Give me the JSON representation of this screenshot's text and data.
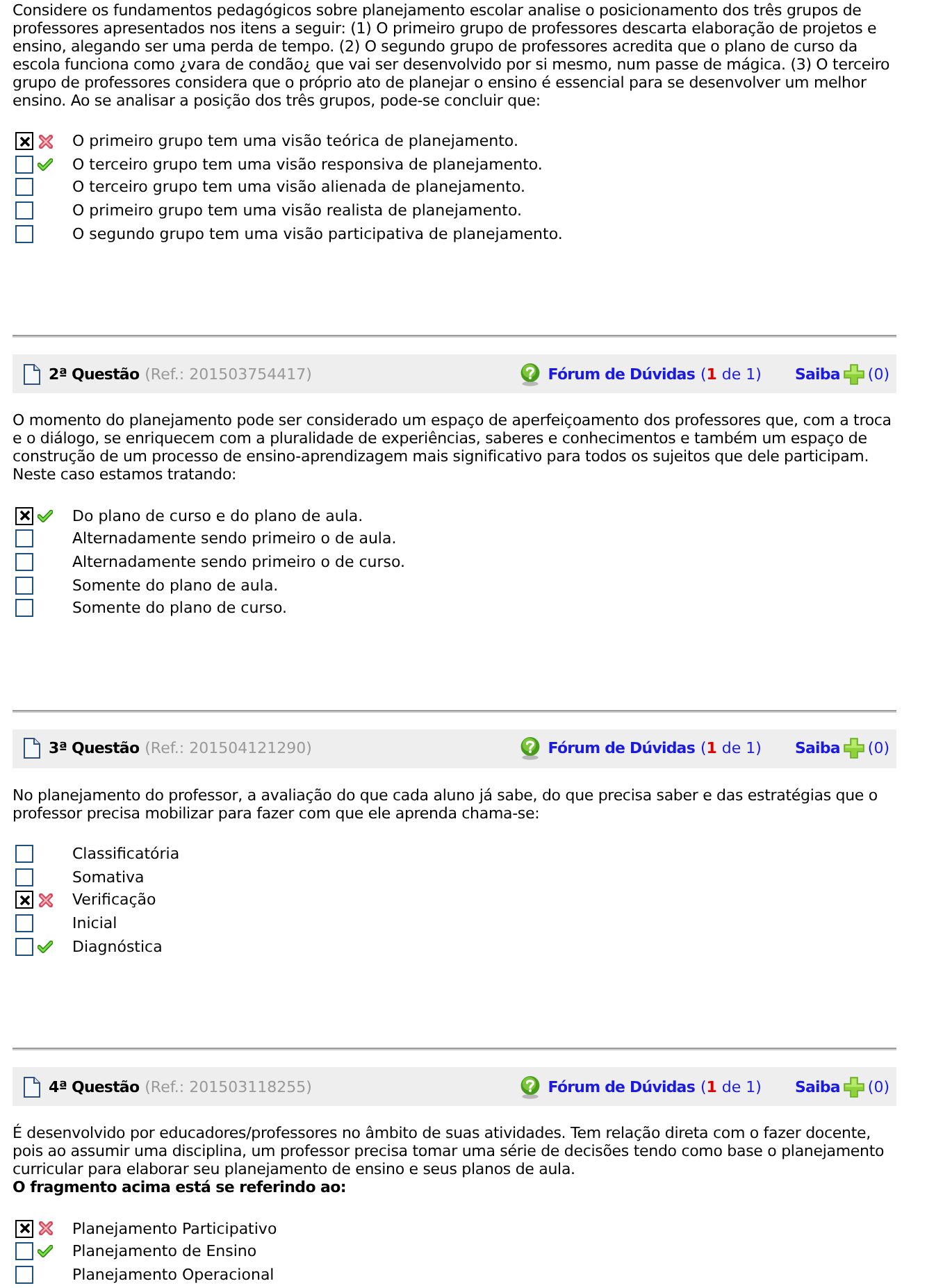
{
  "questions": [
    {
      "statement": "Considere os fundamentos pedagógicos sobre planejamento escolar analise o posicionamento dos três grupos de professores apresentados nos itens a seguir: (1) O primeiro grupo de professores descarta elaboração de projetos e ensino, alegando ser uma perda de tempo. (2) O segundo grupo de professores acredita que o plano de curso da escola funciona como ¿vara de condão¿ que vai ser desenvolvido por si mesmo, num passe de mágica. (3) O terceiro grupo de professores considera que o próprio ato de planejar o ensino é essencial para se desenvolver um melhor ensino. Ao se analisar a posição dos três grupos, pode-se concluir que:",
      "options": [
        {
          "text": "O primeiro grupo tem uma visão teórica de planejamento.",
          "checked": true,
          "correct": false
        },
        {
          "text": "O terceiro grupo tem uma visão responsiva de planejamento.",
          "checked": false,
          "correct": true
        },
        {
          "text": "O terceiro grupo tem uma visão alienada de planejamento.",
          "checked": false,
          "correct": false
        },
        {
          "text": "O primeiro grupo tem uma visão realista de planejamento.",
          "checked": false,
          "correct": false
        },
        {
          "text": "O segundo grupo tem uma visão participativa de planejamento.",
          "checked": false,
          "correct": false
        }
      ]
    },
    {
      "header": {
        "title": "2ª Questão",
        "ref": "(Ref.: 201503754417)",
        "forum_link": "Fórum de Dúvidas",
        "forum_count": "(**1** de 1)",
        "more_link": "Saiba",
        "more_count": "(0)"
      },
      "statement": "O momento do planejamento pode ser considerado um espaço de aperfeiçoamento dos professores que, com a troca e o diálogo, se enriquecem com a pluralidade de experiências, saberes e conhecimentos e também um espaço de construção de um processo de ensino-aprendizagem mais significativo para todos os sujeitos que dele participam. Neste caso estamos tratando:",
      "options": [
        {
          "text": "Do plano de curso e do plano de aula.",
          "checked": true,
          "correct": true
        },
        {
          "text": "Alternadamente sendo primeiro o de aula.",
          "checked": false,
          "correct": false
        },
        {
          "text": "Alternadamente sendo primeiro o de curso.",
          "checked": false,
          "correct": false
        },
        {
          "text": "Somente do plano de aula.",
          "checked": false,
          "correct": false
        },
        {
          "text": "Somente do plano de curso.",
          "checked": false,
          "correct": false
        }
      ]
    },
    {
      "header": {
        "title": "3ª Questão",
        "ref": "(Ref.: 201504121290)",
        "forum_link": "Fórum de Dúvidas",
        "forum_count": "(**1** de 1)",
        "more_link": "Saiba",
        "more_count": "(0)"
      },
      "statement": "No planejamento do professor, a avaliação do que cada aluno já sabe, do que precisa saber e das estratégias que o professor precisa mobilizar para fazer com que ele aprenda chama-se:",
      "options": [
        {
          "text": "Classificatória",
          "checked": false,
          "correct": false
        },
        {
          "text": "Somativa",
          "checked": false,
          "correct": false
        },
        {
          "text": "Verificação",
          "checked": true,
          "correct": false
        },
        {
          "text": "Inicial",
          "checked": false,
          "correct": false
        },
        {
          "text": "Diagnóstica",
          "checked": false,
          "correct": true
        }
      ]
    },
    {
      "header": {
        "title": "4ª Questão",
        "ref": "(Ref.: 201503118255)",
        "forum_link": "Fórum de Dúvidas",
        "forum_count": "(**1** de 1)",
        "more_link": "Saiba",
        "more_count": "(0)"
      },
      "statement": "É desenvolvido por educadores/professores no âmbito de suas atividades. Tem relação direta com o fazer docente, pois ao assumir uma disciplina, um professor precisa tomar uma série de decisões tendo como base o planejamento curricular para elaborar seu planejamento de ensino e seus planos de aula.",
      "prompt": "O fragmento acima está se referindo ao:",
      "options": [
        {
          "text": "Planejamento Participativo",
          "checked": true,
          "correct": false
        },
        {
          "text": "Planejamento de Ensino",
          "checked": false,
          "correct": true
        },
        {
          "text": "Planejamento Operacional",
          "checked": false,
          "correct": false
        }
      ]
    }
  ]
}
